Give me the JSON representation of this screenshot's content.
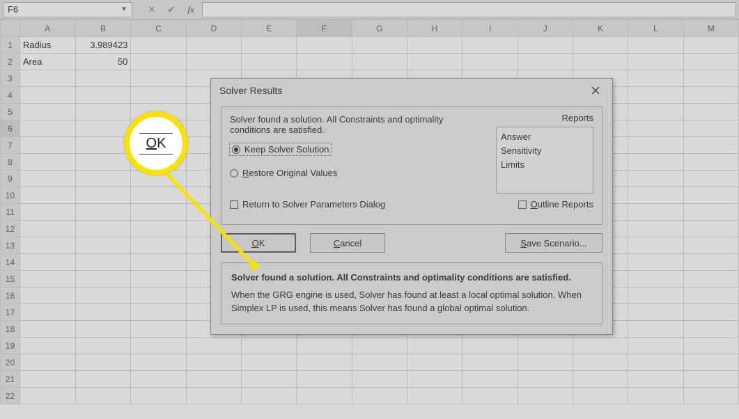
{
  "formula_bar": {
    "name_box": "F6",
    "cancel_glyph": "✕",
    "enter_glyph": "✔",
    "fx_glyph": "fx"
  },
  "columns": [
    "A",
    "B",
    "C",
    "D",
    "E",
    "F",
    "G",
    "H",
    "I",
    "J",
    "K",
    "L",
    "M"
  ],
  "rows": [
    "1",
    "2",
    "3",
    "4",
    "5",
    "6",
    "7",
    "8",
    "9",
    "10",
    "11",
    "12",
    "13",
    "14",
    "15",
    "16",
    "17",
    "18",
    "19",
    "20",
    "21",
    "22"
  ],
  "active_col": "F",
  "active_row": "6",
  "cells": {
    "A1": "Radius",
    "B1": "3.989423",
    "A2": "Area",
    "B2": "50"
  },
  "dialog": {
    "title": "Solver Results",
    "message": "Solver found a solution.  All Constraints and optimality conditions are satisfied.",
    "radio_keep": "Keep Solver Solution",
    "radio_restore": "Restore Original Values",
    "check_return": "Return to Solver Parameters Dialog",
    "reports_label": "Reports",
    "reports": [
      "Answer",
      "Sensitivity",
      "Limits"
    ],
    "check_outline": "Outline Reports",
    "btn_ok": "OK",
    "btn_cancel": "Cancel",
    "btn_save": "Save Scenario...",
    "explain_bold": "Solver found a solution.  All Constraints and optimality conditions are satisfied.",
    "explain_text": "When the GRG engine is used, Solver has found at least a local optimal solution. When Simplex LP is used, this means Solver has found a global optimal solution."
  },
  "callout": {
    "ok_label": "OK"
  }
}
